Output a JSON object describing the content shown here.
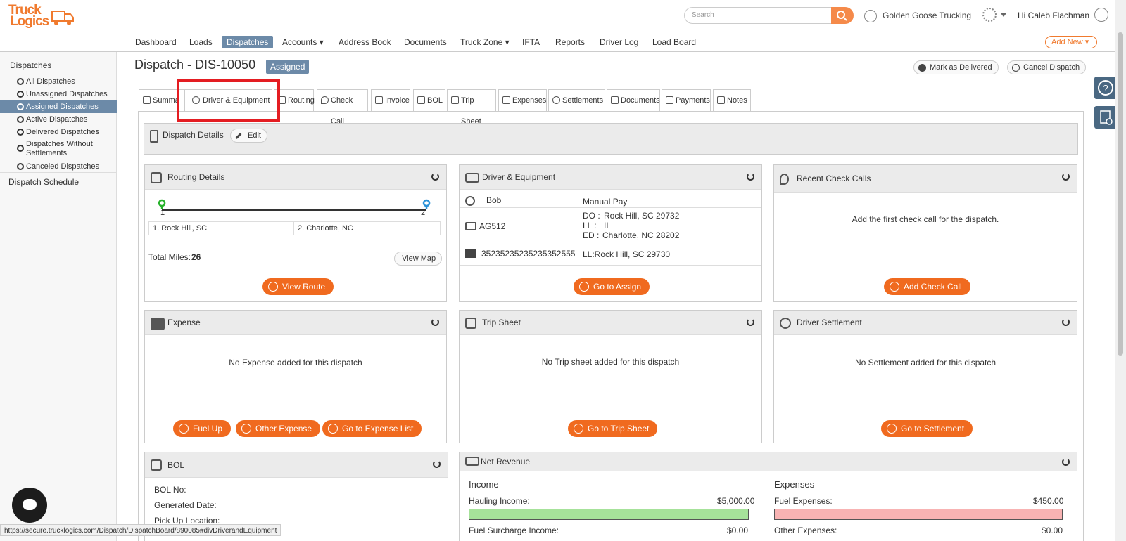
{
  "header": {
    "logo_line1": "Truck",
    "logo_line2": "Logics",
    "search_placeholder": "Search",
    "company": "Golden Goose Trucking",
    "greeting": "Hi Caleb Flachman"
  },
  "nav": {
    "items": [
      "Dashboard",
      "Loads",
      "Dispatches",
      "Accounts ▾",
      "Address Book",
      "Documents",
      "Truck Zone ▾",
      "IFTA",
      "Reports",
      "Driver Log",
      "Load Board"
    ],
    "add_new": "Add New ▾"
  },
  "sidebar": {
    "head": "Dispatches",
    "items": [
      "All Dispatches",
      "Unassigned Dispatches",
      "Assigned Dispatches",
      "Active Dispatches",
      "Delivered Dispatches",
      "Dispatches Without",
      "Settlements",
      "Canceled Dispatches"
    ],
    "schedule": "Dispatch Schedule"
  },
  "page": {
    "title": "Dispatch - DIS-10050",
    "status": "Assigned",
    "mark_delivered": "Mark as Delivered",
    "cancel": "Cancel Dispatch"
  },
  "tabs": [
    "Summa",
    "Driver & Equipment",
    "Routing",
    "Check Call",
    "Invoice",
    "BOL",
    "Trip Sheet",
    "Expenses",
    "Settlements",
    "Documents",
    "Payments",
    "Notes"
  ],
  "details": {
    "title": "Dispatch Details",
    "edit": "Edit"
  },
  "routing": {
    "title": "Routing Details",
    "stop1_num": "1",
    "stop2_num": "2",
    "stop1": "1. Rock Hill, SC",
    "stop2": "2. Charlotte, NC",
    "miles_label": "Total Miles:",
    "miles": "26",
    "view_map": "View Map",
    "view_route": "View Route"
  },
  "driver": {
    "title": "Driver & Equipment",
    "name": "Bob",
    "pay": "Manual Pay",
    "truck": "AG512",
    "do_label": "DO :",
    "do_val": "Rock Hill, SC 29732",
    "ll_label": "LL :",
    "ll_val": "IL",
    "ed_label": "ED :",
    "ed_val": "Charlotte, NC 28202",
    "trailer": "35235235235235352555",
    "trailer_loc": "LL:Rock Hill, SC 29730",
    "button": "Go to Assign"
  },
  "checkcalls": {
    "title": "Recent Check Calls",
    "msg": "Add the first check call for the dispatch.",
    "button": "Add Check Call"
  },
  "expense": {
    "title": "Expense",
    "msg": "No Expense added for this dispatch",
    "b1": "Fuel Up",
    "b2": "Other Expense",
    "b3": "Go to Expense List"
  },
  "tripsheet": {
    "title": "Trip Sheet",
    "msg": "No Trip sheet added for this dispatch",
    "button": "Go to Trip Sheet"
  },
  "settlement": {
    "title": "Driver Settlement",
    "msg": "No Settlement added for this dispatch",
    "button": "Go to Settlement"
  },
  "bol": {
    "title": "BOL",
    "no": "BOL No:",
    "gen": "Generated Date:",
    "pick": "Pick Up Location:"
  },
  "revenue": {
    "title": "Net Revenue",
    "income": "Income",
    "expenses": "Expenses",
    "hauling_label": "Hauling Income:",
    "hauling": "$5,000.00",
    "fuel_label": "Fuel Expenses:",
    "fuel": "$450.00",
    "surcharge_label": "Fuel Surcharge Income:",
    "surcharge": "$0.00",
    "other_label": "Other Expenses:",
    "other": "$0.00",
    "income_color": "#a6e29a",
    "expense_color": "#f8b3b3"
  },
  "status_url": "https://secure.trucklogics.com/Dispatch/DispatchBoard/890085#divDriverandEquipment"
}
